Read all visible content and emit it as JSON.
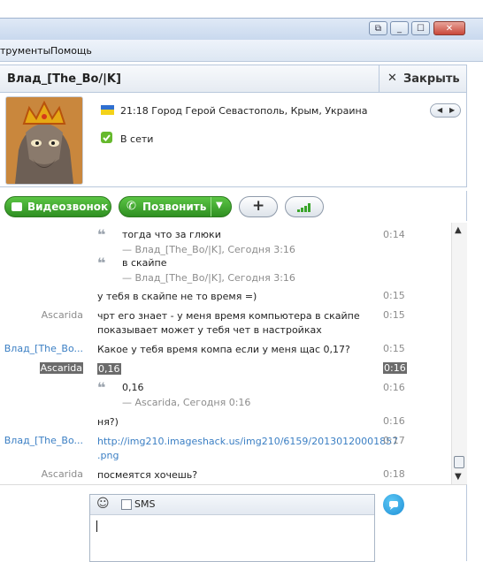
{
  "menu": {
    "items": [
      "трументы",
      "Помощь"
    ]
  },
  "contact": {
    "name": "Влад_[The_Bo/|K]",
    "close_label": "Закрыть"
  },
  "profile": {
    "local_info": "21:18 Город Герой Севастополь, Крым, Украина",
    "status": "В сети"
  },
  "toolbar": {
    "video_label": "Видеозвонок",
    "call_label": "Позвонить"
  },
  "chat": {
    "q1_text": "тогда что за глюки",
    "q1_src": "— Влад_[The_Bo/|K], Сегодня 3:16",
    "q1_time": "0:14",
    "q2_text": "в скайпе",
    "q2_src": "— Влад_[The_Bo/|K], Сегодня 3:16",
    "m1_text": "у тебя в скайпе не то время =)",
    "m1_time": "0:15",
    "m2_sender": "Ascarida",
    "m2_line1": "чрт его знает  - у меня время компьютера в скайпе",
    "m2_line2": "показывает может у тебя чет в настройках",
    "m2_time": "0:15",
    "m3_sender": "Влад_[The_Bo...",
    "m3_text": "Какое у тебя время компа если у меня щас 0,17?",
    "m3_time": "0:15",
    "m4_sender": "Ascarida",
    "m4_text": "0,16",
    "m4_time": "0:16",
    "q3_text": "0,16",
    "q3_src": "— Ascarida, Сегодня 0:16",
    "q3_time": "0:16",
    "m5_text": "ня?)",
    "m5_time": "0:16",
    "m6_sender": "Влад_[The_Bo...",
    "m6_line1": "http://img210.imageshack.us/img210/6159/20130120001857",
    "m6_line2": ".png",
    "m6_time": "0:17",
    "m7_sender": "Ascarida",
    "m7_text": "посмеятся хочешь?",
    "m7_time": "0:18"
  },
  "compose": {
    "sms_label": "SMS"
  },
  "colors": {
    "accent_green": "#3aa52a",
    "link_blue": "#3b7fc4",
    "highlight": "#6b6b6b"
  },
  "icons": [
    "restore-icon",
    "minimize-icon",
    "maximize-icon",
    "close-icon",
    "ukraine-flag-icon",
    "online-status-icon",
    "video-camera-icon",
    "phone-icon",
    "plus-icon",
    "signal-bars-icon",
    "quote-icon",
    "emoticon-icon",
    "send-icon"
  ]
}
